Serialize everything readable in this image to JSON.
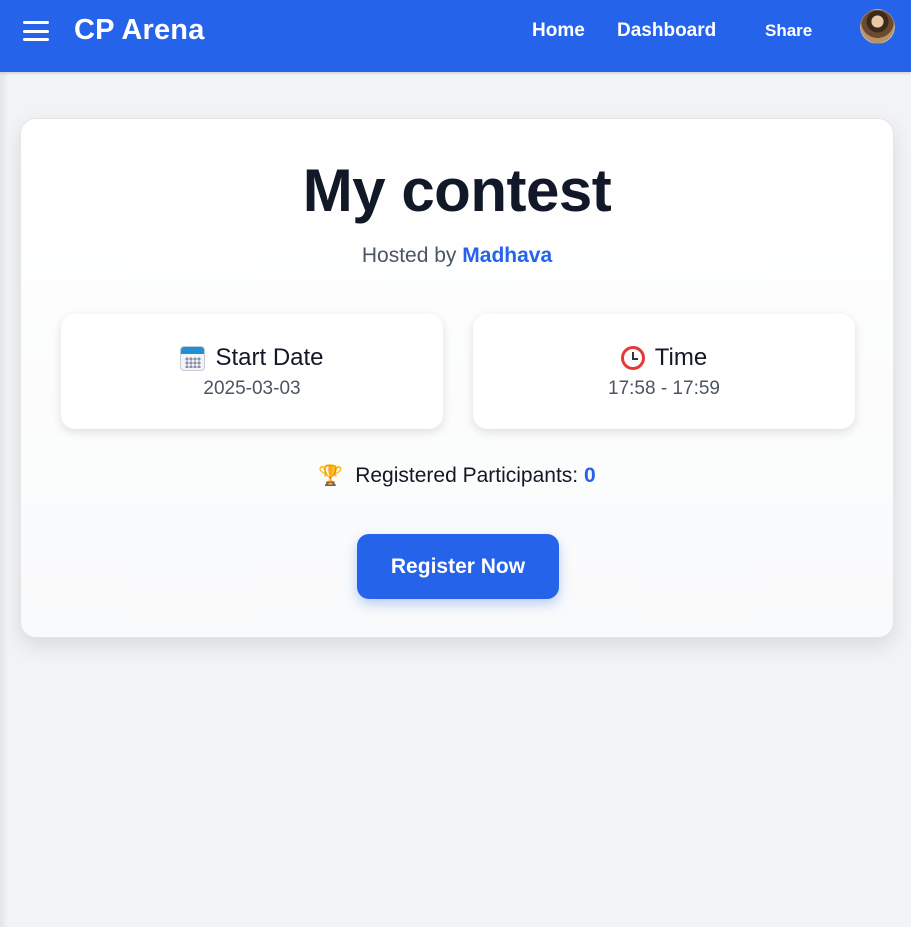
{
  "navbar": {
    "brand": "CP Arena",
    "links": {
      "home": "Home",
      "dashboard": "Dashboard",
      "share": "Share"
    }
  },
  "contest": {
    "title": "My contest",
    "hosted_prefix": "Hosted by",
    "host_name": "Madhava",
    "start_date": {
      "label": "Start Date",
      "value": "2025-03-03",
      "icon": "calendar-icon"
    },
    "time": {
      "label": "Time",
      "value": "17:58 - 17:59",
      "icon": "alarm-clock-icon"
    },
    "participants": {
      "label": "Registered Participants:",
      "count": "0",
      "icon": "trophy-icon"
    },
    "register_button": "Register Now"
  },
  "colors": {
    "primary": "#2563eb",
    "title": "#111827",
    "muted": "#4b5563",
    "background": "#f2f3f5"
  }
}
